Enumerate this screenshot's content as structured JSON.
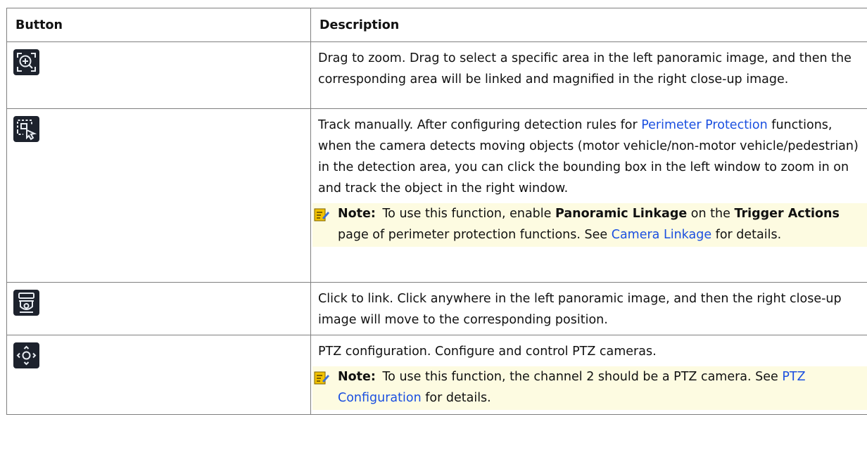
{
  "table": {
    "headers": [
      "Button",
      "Description"
    ],
    "rows": [
      {
        "icon": "zoom-in-frame-icon",
        "description": "Drag to zoom. Drag to select a specific area in the left panoramic image, and then the corresponding area will be linked and magnified in the right close-up image."
      },
      {
        "icon": "manual-track-icon",
        "d_pre": "Track manually. After configuring detection rules for ",
        "d_link": "Perimeter Protection",
        "d_post": " functions, when the camera detects moving objects (motor vehicle/non-motor vehicle/pedestrian) in the detection area, you can click the bounding box in the left window to zoom in on and track the object in the right window.",
        "note": {
          "label": "Note:",
          "p1": " To use this function, enable ",
          "b1": "Panoramic Linkage",
          "p2": " on the ",
          "b2": "Trigger Actions",
          "p3": " page of perimeter protection functions. See ",
          "link": "Camera Linkage",
          "p4": " for details."
        }
      },
      {
        "icon": "dome-camera-link-icon",
        "description": "Click to link. Click anywhere in the left panoramic image, and then the right close-up image will move to the corresponding position."
      },
      {
        "icon": "ptz-control-icon",
        "description": "PTZ configuration. Configure and control PTZ cameras.",
        "note": {
          "label": "Note:",
          "p1": " To use this function, the channel 2 should be a PTZ camera. See ",
          "link": "PTZ Configuration",
          "p2": " for details."
        }
      }
    ]
  },
  "colors": {
    "link": "#1a4fe0",
    "note_bg": "#fdfbe1",
    "icon_bg": "#1d222d",
    "border": "#7f7f7f"
  }
}
